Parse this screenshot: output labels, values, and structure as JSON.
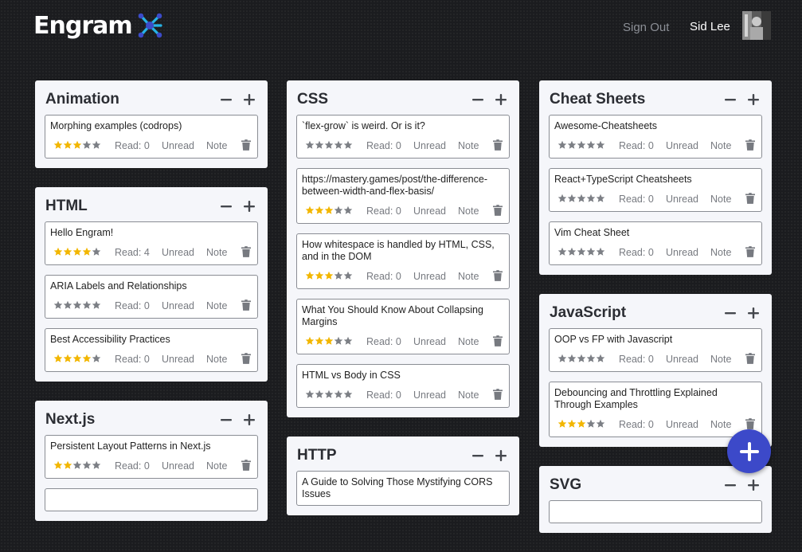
{
  "header": {
    "logo_text": "Engram",
    "signout_label": "Sign Out",
    "user_name": "Sid Lee"
  },
  "colors": {
    "accent": "#3c49c9",
    "star_filled": "#f2b600",
    "star_empty": "#7c7f85",
    "card_bg": "#f5f6fa",
    "page_bg": "#1b1c1f"
  },
  "columns": [
    [
      {
        "title": "Animation",
        "items": [
          {
            "title": "Morphing examples (codrops)",
            "rating": 3,
            "read": "Read: 0",
            "unread": "Unread",
            "note": "Note"
          }
        ]
      },
      {
        "title": "HTML",
        "items": [
          {
            "title": "Hello Engram!",
            "rating": 4,
            "read": "Read: 4",
            "unread": "Unread",
            "note": "Note"
          },
          {
            "title": "ARIA Labels and Relationships",
            "rating": 0,
            "read": "Read: 0",
            "unread": "Unread",
            "note": "Note"
          },
          {
            "title": "Best Accessibility Practices",
            "rating": 4,
            "read": "Read: 0",
            "unread": "Unread",
            "note": "Note"
          }
        ]
      },
      {
        "title": "Next.js",
        "items": [
          {
            "title": "Persistent Layout Patterns in Next.js",
            "rating": 2,
            "read": "Read: 0",
            "unread": "Unread",
            "note": "Note"
          },
          {
            "title": "",
            "rating": 0,
            "read": "",
            "unread": "",
            "note": ""
          }
        ]
      }
    ],
    [
      {
        "title": "CSS",
        "items": [
          {
            "title": "`flex-grow` is weird. Or is it?",
            "rating": 0,
            "read": "Read: 0",
            "unread": "Unread",
            "note": "Note"
          },
          {
            "title": "https://mastery.games/post/the-difference-between-width-and-flex-basis/",
            "rating": 3,
            "read": "Read: 0",
            "unread": "Unread",
            "note": "Note"
          },
          {
            "title": "How whitespace is handled by HTML, CSS, and in the DOM",
            "rating": 3,
            "read": "Read: 0",
            "unread": "Unread",
            "note": "Note"
          },
          {
            "title": "What You Should Know About Collapsing Margins",
            "rating": 3,
            "read": "Read: 0",
            "unread": "Unread",
            "note": "Note"
          },
          {
            "title": "HTML vs Body in CSS",
            "rating": 0,
            "read": "Read: 0",
            "unread": "Unread",
            "note": "Note"
          }
        ]
      },
      {
        "title": "HTTP",
        "items": [
          {
            "title": "A Guide to Solving Those Mystifying CORS Issues",
            "rating": 0,
            "read": "",
            "unread": "",
            "note": ""
          }
        ]
      }
    ],
    [
      {
        "title": "Cheat Sheets",
        "items": [
          {
            "title": "Awesome-Cheatsheets",
            "rating": 0,
            "read": "Read: 0",
            "unread": "Unread",
            "note": "Note"
          },
          {
            "title": "React+TypeScript Cheatsheets",
            "rating": 0,
            "read": "Read: 0",
            "unread": "Unread",
            "note": "Note"
          },
          {
            "title": "Vim Cheat Sheet",
            "rating": 0,
            "read": "Read: 0",
            "unread": "Unread",
            "note": "Note"
          }
        ]
      },
      {
        "title": "JavaScript",
        "items": [
          {
            "title": "OOP vs FP with Javascript",
            "rating": 0,
            "read": "Read: 0",
            "unread": "Unread",
            "note": "Note"
          },
          {
            "title": "Debouncing and Throttling Explained Through Examples",
            "rating": 3,
            "read": "Read: 0",
            "unread": "Unread",
            "note": "Note"
          }
        ]
      },
      {
        "title": "SVG",
        "items": [
          {
            "title": "",
            "rating": 0,
            "read": "",
            "unread": "",
            "note": ""
          }
        ]
      }
    ]
  ]
}
